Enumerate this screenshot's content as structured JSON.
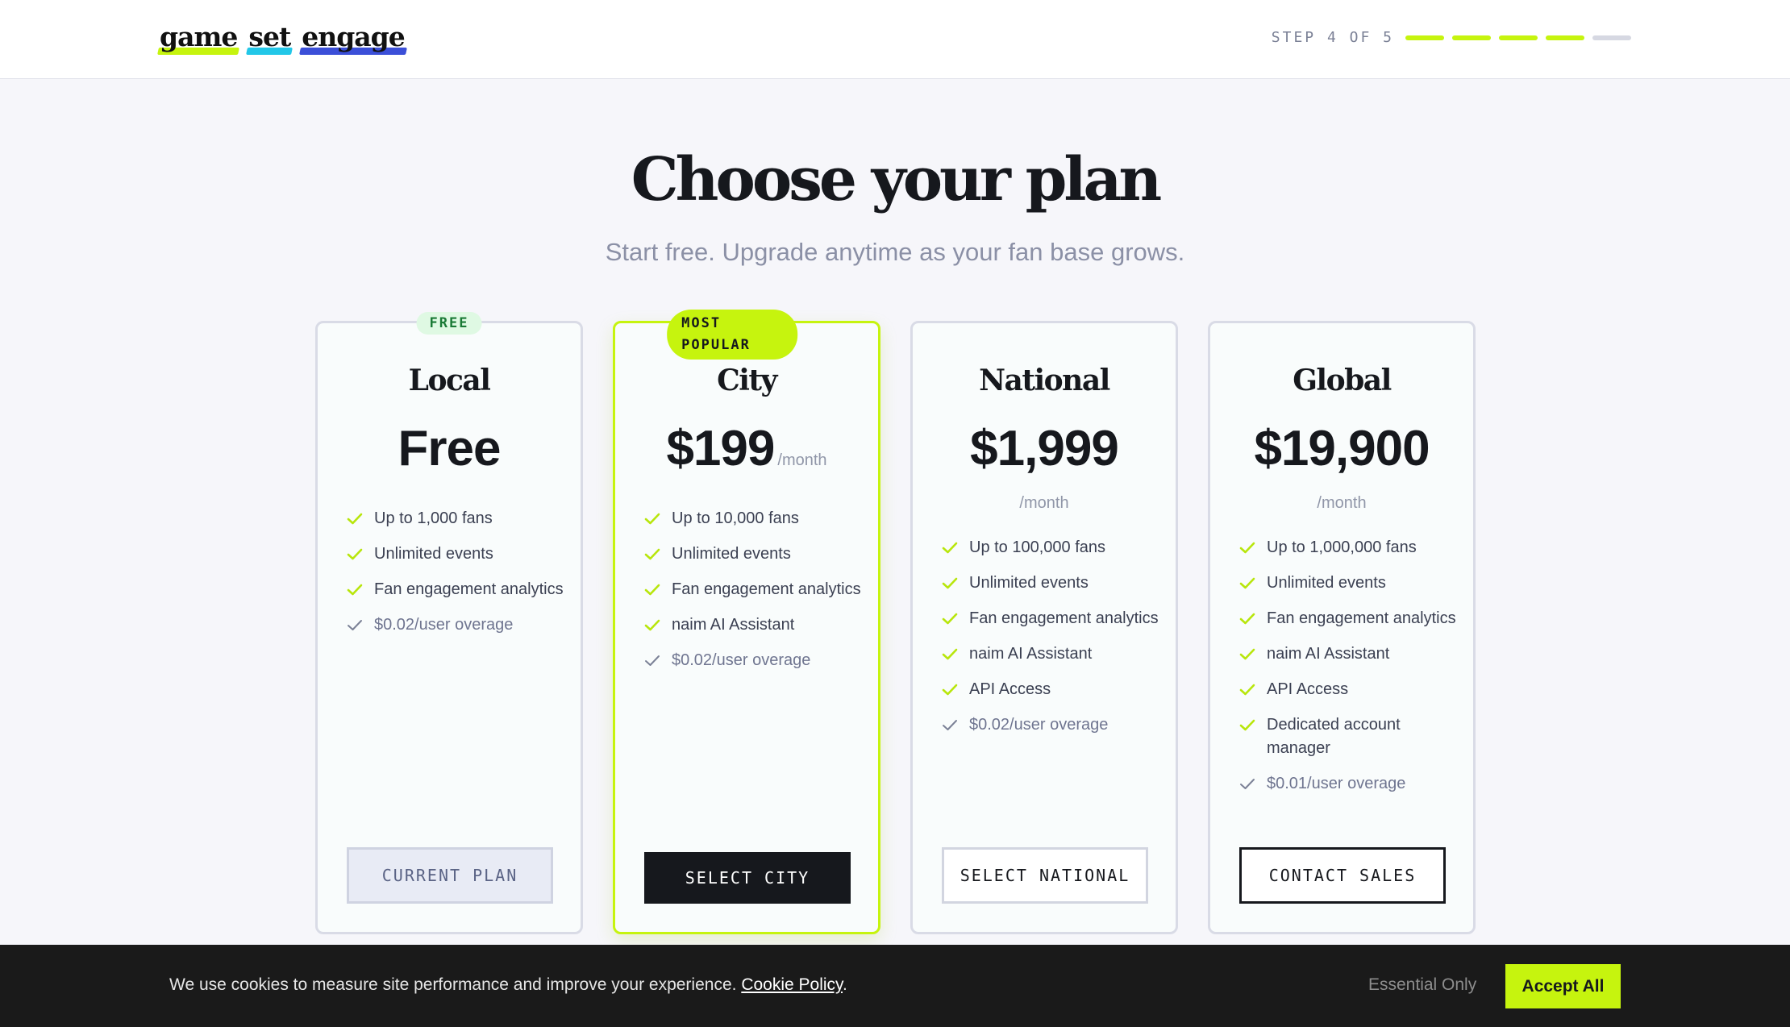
{
  "header": {
    "logo": [
      "game",
      "set",
      "engage"
    ],
    "logo_colors": [
      "#c6f40e",
      "#22c7e8",
      "#3b4fd8"
    ],
    "step_label": "STEP 4 OF 5",
    "step_current": 4,
    "step_total": 5
  },
  "hero": {
    "title": "Choose your plan",
    "subtitle": "Start free. Upgrade anytime as your fan base grows."
  },
  "plans": [
    {
      "badge": "FREE",
      "name": "Local",
      "price": "Free",
      "per": "",
      "features": [
        "Up to 1,000 fans",
        "Unlimited events",
        "Fan engagement analytics"
      ],
      "overage": "$0.02/user overage",
      "button": "CURRENT PLAN"
    },
    {
      "badge": "MOST POPULAR",
      "name": "City",
      "price": "$199",
      "per": "/month",
      "features": [
        "Up to 10,000 fans",
        "Unlimited events",
        "Fan engagement analytics",
        "naim AI Assistant"
      ],
      "overage": "$0.02/user overage",
      "button": "SELECT CITY"
    },
    {
      "badge": "",
      "name": "National",
      "price": "$1,999",
      "per": "/month",
      "features": [
        "Up to 100,000 fans",
        "Unlimited events",
        "Fan engagement analytics",
        "naim AI Assistant",
        "API Access"
      ],
      "overage": "$0.02/user overage",
      "button": "SELECT NATIONAL"
    },
    {
      "badge": "",
      "name": "Global",
      "price": "$19,900",
      "per": "/month",
      "features": [
        "Up to 1,000,000 fans",
        "Unlimited events",
        "Fan engagement analytics",
        "naim AI Assistant",
        "API Access",
        "Dedicated account manager"
      ],
      "overage": "$0.01/user overage",
      "button": "CONTACT SALES"
    }
  ],
  "cookie": {
    "text": "We use cookies to measure site performance and improve your experience.",
    "link": "Cookie Policy",
    "suffix": ".",
    "essential": "Essential Only",
    "accept": "Accept All"
  },
  "colors": {
    "accent": "#c6f40e",
    "dark": "#16181d",
    "check": "#b8e60c",
    "check_muted": "#7b8196"
  }
}
